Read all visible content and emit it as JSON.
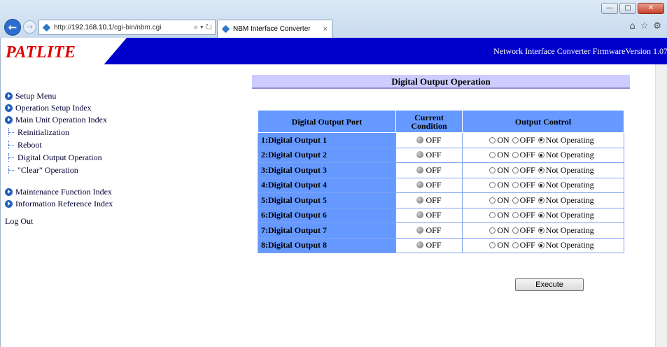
{
  "window": {
    "minimize_glyph": "—",
    "maximize_glyph": "□",
    "close_glyph": "✕"
  },
  "browser": {
    "back_glyph": "←",
    "forward_glyph": "→",
    "address_prefix": "http://",
    "address_host": "192.168.10.1",
    "address_path": "/cgi-bin/nbm.cgi",
    "address_tools": "⌕ ▾ ↻",
    "tab_title": "NBM Interface Converter",
    "tab_close": "×",
    "home_glyph": "⌂",
    "favorites_glyph": "☆",
    "settings_glyph": "⚙"
  },
  "header": {
    "logo": "PATLITE",
    "firmware_text": "Network Interface Converter  FirmwareVersion 1.07"
  },
  "nav": {
    "setup_menu": "Setup Menu",
    "operation_setup_index": "Operation Setup Index",
    "main_unit_operation_index": "Main Unit Operation Index",
    "sub_items": [
      "Reinitialization",
      "Reboot",
      "Digital Output Operation",
      "\"Clear\" Operation"
    ],
    "maintenance_function_index": "Maintenance Function Index",
    "information_reference_index": "Information Reference Index",
    "log_out": "Log Out"
  },
  "main": {
    "title": "Digital Output Operation",
    "headers": {
      "port": "Digital Output Port",
      "current_line1": "Current",
      "current_line2": "Condition",
      "control": "Output Control"
    },
    "option_labels": {
      "on": "ON",
      "off": "OFF",
      "not_operating": "Not Operating"
    },
    "rows": [
      {
        "port": "1:Digital Output 1",
        "condition": "OFF",
        "selected": "not_operating"
      },
      {
        "port": "2:Digital Output 2",
        "condition": "OFF",
        "selected": "not_operating"
      },
      {
        "port": "3:Digital Output 3",
        "condition": "OFF",
        "selected": "not_operating"
      },
      {
        "port": "4:Digital Output 4",
        "condition": "OFF",
        "selected": "not_operating"
      },
      {
        "port": "5:Digital Output 5",
        "condition": "OFF",
        "selected": "not_operating"
      },
      {
        "port": "6:Digital Output 6",
        "condition": "OFF",
        "selected": "not_operating"
      },
      {
        "port": "7:Digital Output 7",
        "condition": "OFF",
        "selected": "not_operating"
      },
      {
        "port": "8:Digital Output 8",
        "condition": "OFF",
        "selected": "not_operating"
      }
    ],
    "execute_label": "Execute"
  },
  "colors": {
    "header_band": "#0000cc",
    "logo_red": "#e00000",
    "table_header": "#6699ff",
    "title_bar": "#ccccff"
  }
}
